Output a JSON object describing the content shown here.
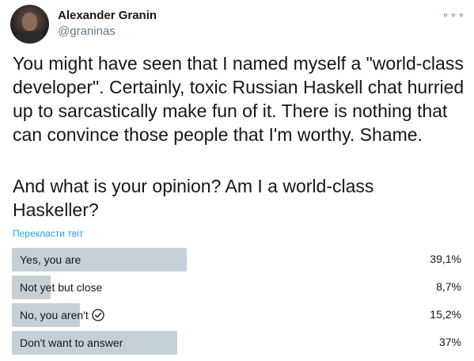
{
  "author": {
    "name": "Alexander Granin",
    "handle": "@graninas"
  },
  "tweet": {
    "text": "You might have seen that I named myself a \"world-class\ndeveloper\". Certainly, toxic Russian Haskell chat hurried\nup to sarcastically make fun of it. There is nothing that\ncan convince those people that I'm worthy. Shame.",
    "question": "And what is your opinion? Am I a world-class\nHaskeller?",
    "translate_link": "Перекласти твіт"
  },
  "icons": {
    "more": "more-options-icon",
    "check": "check-circle-icon"
  },
  "colors": {
    "bar": "#c5d0d6",
    "link": "#1da1f2",
    "secondary_text": "#657786"
  },
  "poll": {
    "options": [
      {
        "label": "Yes, you are",
        "percent": "39,1%",
        "value": 39.1,
        "selected": false
      },
      {
        "label": "Not yet but close",
        "percent": "8,7%",
        "value": 8.7,
        "selected": false
      },
      {
        "label": "No, you aren't",
        "percent": "15,2%",
        "value": 15.2,
        "selected": true
      },
      {
        "label": "Don't want to answer",
        "percent": "37%",
        "value": 37,
        "selected": false
      }
    ]
  }
}
